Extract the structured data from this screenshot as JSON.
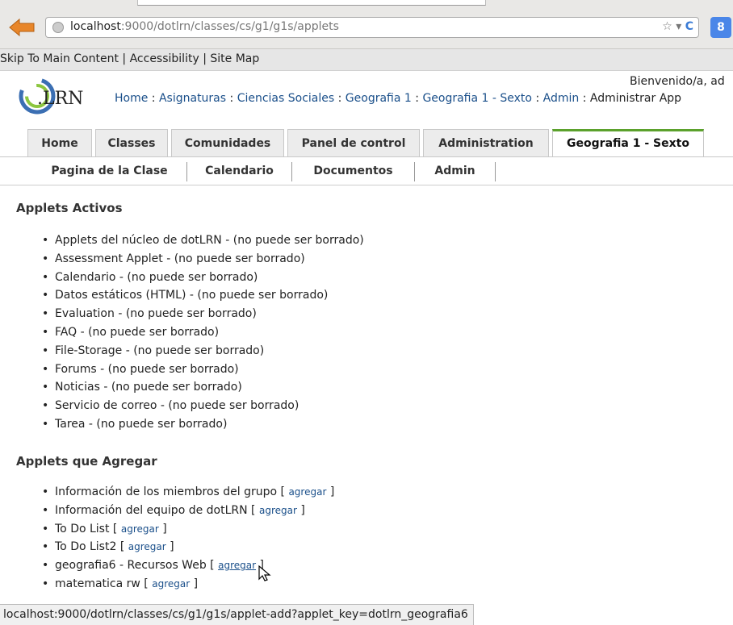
{
  "browser": {
    "url_host": "localhost",
    "url_path": ":9000/dotlrn/classes/cs/g1/g1s/applets",
    "url_icons": "☆ ▾",
    "reload_glyph": "C",
    "search_engine_glyph": "8"
  },
  "skip_bar": {
    "skip": "Skip To Main Content",
    "sep1": " | ",
    "accessibility": "Accessibility",
    "sep2": " | ",
    "sitemap": "Site Map"
  },
  "header": {
    "logo_text": ".LRN",
    "welcome": "Bienvenido/a, ad",
    "breadcrumb": [
      {
        "label": "Home"
      },
      {
        "label": "Asignaturas"
      },
      {
        "label": "Ciencias Sociales"
      },
      {
        "label": "Geografia 1"
      },
      {
        "label": "Geografia 1 - Sexto"
      },
      {
        "label": "Admin"
      }
    ],
    "breadcrumb_sep": " : ",
    "breadcrumb_last": "Administrar App"
  },
  "tabs": [
    {
      "label": "Home"
    },
    {
      "label": "Classes"
    },
    {
      "label": "Comunidades"
    },
    {
      "label": "Panel de control"
    },
    {
      "label": "Administration"
    },
    {
      "label": "Geografia 1 - Sexto",
      "active": true
    }
  ],
  "subtabs": [
    {
      "label": "Pagina de la Clase"
    },
    {
      "label": "Calendario"
    },
    {
      "label": "Documentos"
    },
    {
      "label": "Admin"
    }
  ],
  "active_section": {
    "title": "Applets Activos",
    "items": [
      "Applets del núcleo de dotLRN - (no puede ser borrado)",
      "Assessment Applet - (no puede ser borrado)",
      "Calendario - (no puede ser borrado)",
      "Datos estáticos (HTML) - (no puede ser borrado)",
      "Evaluation - (no puede ser borrado)",
      "FAQ - (no puede ser borrado)",
      "File-Storage - (no puede ser borrado)",
      "Forums - (no puede ser borrado)",
      "Noticias - (no puede ser borrado)",
      "Servicio de correo - (no puede ser borrado)",
      "Tarea - (no puede ser borrado)"
    ]
  },
  "add_section": {
    "title": "Applets que Agregar",
    "link_label": "agregar",
    "bracket_open": " [ ",
    "bracket_close": " ]",
    "items": [
      "Información de los miembros del grupo",
      "Información del equipo de dotLRN",
      "To Do List",
      "To Do List2",
      "geografia6 - Recursos Web",
      "matematica rw"
    ],
    "hovered_index": 4
  },
  "status_bar": {
    "text": "localhost:9000/dotlrn/classes/cs/g1/g1s/applet-add?applet_key=dotlrn_geografia6"
  },
  "colors": {
    "link": "#1a4f8a",
    "active_tab_accent": "#5ba12c",
    "back_arrow": "#e8862a"
  }
}
